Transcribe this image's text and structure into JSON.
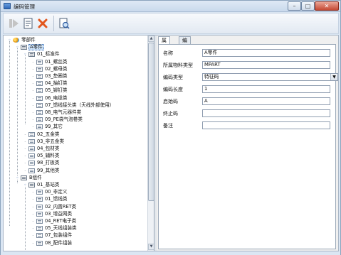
{
  "window": {
    "title": "编码管理"
  },
  "title_buttons": {
    "minimize": "–",
    "maximize": "□",
    "close": "✕"
  },
  "toolbar": {
    "buttons": [
      {
        "icon": "play-icon",
        "enabled": false
      },
      {
        "icon": "document-icon",
        "enabled": true
      },
      {
        "icon": "delete-icon",
        "enabled": true
      },
      {
        "icon": "preview-icon",
        "enabled": true
      }
    ]
  },
  "tree": {
    "nodes": [
      {
        "label": "零部件",
        "level": 0,
        "icon": "root",
        "expanded": true
      },
      {
        "label": "A零件",
        "level": 1,
        "icon": "folder",
        "expanded": true,
        "selected": true
      },
      {
        "label": "01_标准件",
        "level": 2,
        "icon": "folder",
        "expanded": true
      },
      {
        "label": "01_螺丝类",
        "level": 3,
        "icon": "leaf"
      },
      {
        "label": "02_螺母类",
        "level": 3,
        "icon": "leaf"
      },
      {
        "label": "03_垫圈类",
        "level": 3,
        "icon": "leaf"
      },
      {
        "label": "04_抽钉类",
        "level": 3,
        "icon": "leaf"
      },
      {
        "label": "05_铆钉类",
        "level": 3,
        "icon": "leaf"
      },
      {
        "label": "06_电缆类",
        "level": 3,
        "icon": "leaf"
      },
      {
        "label": "07_馈线接头类（天线外部使用）",
        "level": 3,
        "icon": "leaf"
      },
      {
        "label": "08_电气元器件类",
        "level": 3,
        "icon": "leaf"
      },
      {
        "label": "09_PE袋气泡卷类",
        "level": 3,
        "icon": "leaf"
      },
      {
        "label": "99_其它",
        "level": 3,
        "icon": "leaf"
      },
      {
        "label": "02_五金类",
        "level": 2,
        "icon": "leaf"
      },
      {
        "label": "03_非五金类",
        "level": 2,
        "icon": "leaf"
      },
      {
        "label": "04_包材类",
        "level": 2,
        "icon": "leaf"
      },
      {
        "label": "05_辅料类",
        "level": 2,
        "icon": "leaf"
      },
      {
        "label": "98_打板类",
        "level": 2,
        "icon": "leaf"
      },
      {
        "label": "99_其他类",
        "level": 2,
        "icon": "leaf"
      },
      {
        "label": "B组件",
        "level": 1,
        "icon": "folder",
        "expanded": true
      },
      {
        "label": "01_基站类",
        "level": 2,
        "icon": "folder",
        "expanded": true
      },
      {
        "label": "00_非定义",
        "level": 3,
        "icon": "leaf"
      },
      {
        "label": "01_馈线类",
        "level": 3,
        "icon": "leaf"
      },
      {
        "label": "02_内置RET类",
        "level": 3,
        "icon": "leaf"
      },
      {
        "label": "03_增益网类",
        "level": 3,
        "icon": "leaf"
      },
      {
        "label": "04_RET电子类",
        "level": 3,
        "icon": "leaf"
      },
      {
        "label": "05_天线组装类",
        "level": 3,
        "icon": "leaf"
      },
      {
        "label": "07_包装组件",
        "level": 3,
        "icon": "leaf"
      },
      {
        "label": "08_配件组装",
        "level": 3,
        "icon": "leaf"
      }
    ]
  },
  "tabs": [
    {
      "label": "属性",
      "active": true
    },
    {
      "label": "编码",
      "active": false
    }
  ],
  "properties": [
    {
      "label": "名称",
      "value": "A零件",
      "type": "text"
    },
    {
      "label": "所属物料类型",
      "value": "MPART",
      "type": "text"
    },
    {
      "label": "编码类型",
      "value": "特征码",
      "type": "dropdown"
    },
    {
      "label": "编码长度",
      "value": "1",
      "type": "text"
    },
    {
      "label": "启始码",
      "value": "A",
      "type": "text"
    },
    {
      "label": "终止码",
      "value": "",
      "type": "text"
    },
    {
      "label": "备注",
      "value": "",
      "type": "text"
    }
  ],
  "colors": {
    "accent": "#3b6fb6",
    "selection": "#cde2f8",
    "window_bg": "#dbe6f3"
  }
}
